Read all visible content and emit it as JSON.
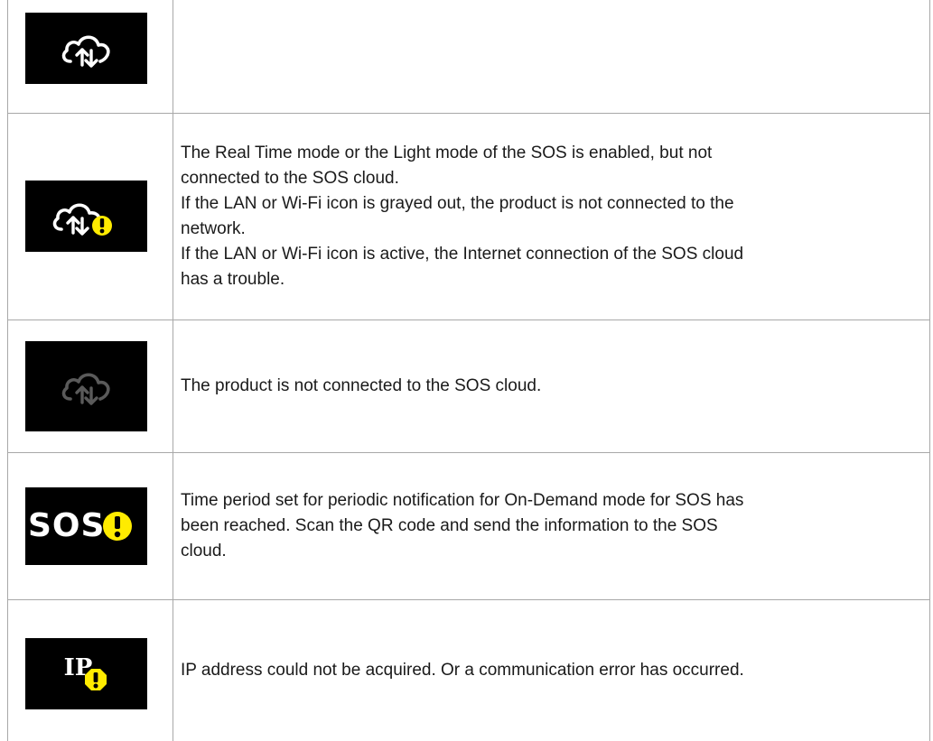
{
  "rows": [
    {
      "icon": "cloud-sync-icon",
      "description": []
    },
    {
      "icon": "cloud-sync-warning-icon",
      "description": [
        "The Real Time mode or the Light mode of the SOS is enabled, but not",
        "connected to the SOS cloud.",
        "If the LAN or Wi-Fi icon is grayed out, the product is not connected to the",
        "network.",
        "If the LAN or Wi-Fi icon is active, the Internet connection of the SOS cloud",
        "has a trouble."
      ]
    },
    {
      "icon": "cloud-sync-disconnected-icon",
      "description": [
        "The product is not connected to the SOS cloud."
      ]
    },
    {
      "icon": "sos-warning-icon",
      "icon_text": "SOS",
      "description": [
        "Time period set for periodic notification for On-Demand mode for SOS has",
        "been reached. Scan the QR code and send the information to the SOS",
        "cloud."
      ]
    },
    {
      "icon": "ip-warning-icon",
      "icon_text": "IP",
      "description": [
        "IP address could not be acquired. Or a communication error has occurred."
      ]
    }
  ],
  "colors": {
    "icon_background": "#000000",
    "icon_foreground": "#ffffff",
    "icon_disabled": "#5a5a5a",
    "warning": "#ffeb00",
    "border": "#a8a8a8",
    "text": "#1a1a1a"
  }
}
